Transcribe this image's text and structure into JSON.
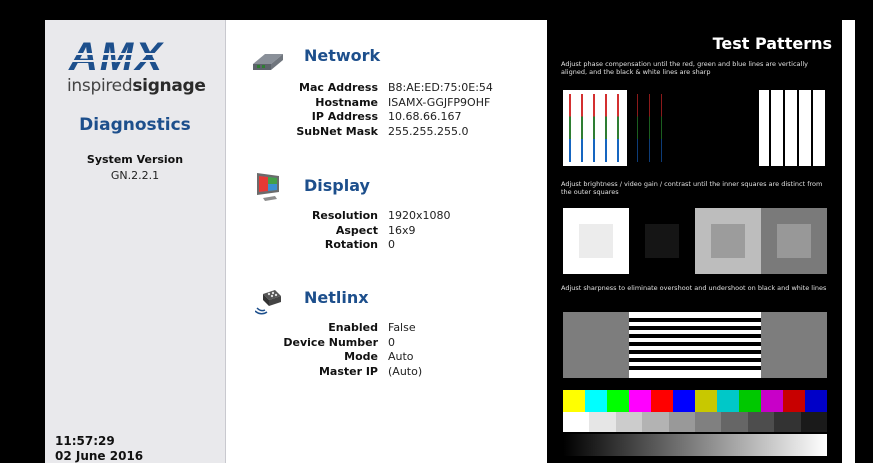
{
  "brand": {
    "logo_text": "AMX",
    "tagline_light": "inspired",
    "tagline_bold": "signage",
    "logo_color": "#1d4f8c"
  },
  "sidebar": {
    "title": "Diagnostics",
    "system_version_label": "System Version",
    "system_version_value": "GN.2.2.1",
    "time": "11:57:29",
    "date": "02 June 2016"
  },
  "network": {
    "title": "Network",
    "icon": "network-icon",
    "rows": [
      {
        "key": "Mac Address",
        "value": "B8:AE:ED:75:0E:54"
      },
      {
        "key": "Hostname",
        "value": "ISAMX-GGJFP9OHF"
      },
      {
        "key": "IP Address",
        "value": "10.68.66.167"
      },
      {
        "key": "SubNet Mask",
        "value": "255.255.255.0"
      }
    ]
  },
  "display": {
    "title": "Display",
    "icon": "monitor-icon",
    "rows": [
      {
        "key": "Resolution",
        "value": "1920x1080"
      },
      {
        "key": "Aspect",
        "value": "16x9"
      },
      {
        "key": "Rotation",
        "value": "0"
      }
    ]
  },
  "netlinx": {
    "title": "Netlinx",
    "icon": "netlinx-icon",
    "rows": [
      {
        "key": "Enabled",
        "value": "False"
      },
      {
        "key": "Device Number",
        "value": "0"
      },
      {
        "key": "Mode",
        "value": "Auto"
      },
      {
        "key": "Master IP",
        "value": "(Auto)"
      }
    ]
  },
  "test_patterns": {
    "title": "Test Patterns",
    "note_color": "Adjust phase compensation until the red, green and blue lines are vertically aligned, and the black & white lines are sharp",
    "note_brightness": "Adjust brightness / video gain / contrast until the inner squares are distinct from the outer squares",
    "note_sharpness": "Adjust sharpness to eliminate overshoot and undershoot on black and white lines",
    "color_bars": [
      "#ffff00",
      "#00ffff",
      "#00ff00",
      "#ff00ff",
      "#ff0000",
      "#0000ff",
      "#c8c800",
      "#00c8c8",
      "#00c800",
      "#c800c8",
      "#c80000",
      "#0000c8"
    ],
    "gray_bars": [
      "#ffffff",
      "#e6e6e6",
      "#cccccc",
      "#b3b3b3",
      "#999999",
      "#808080",
      "#666666",
      "#4d4d4d",
      "#333333",
      "#1a1a1a"
    ]
  }
}
